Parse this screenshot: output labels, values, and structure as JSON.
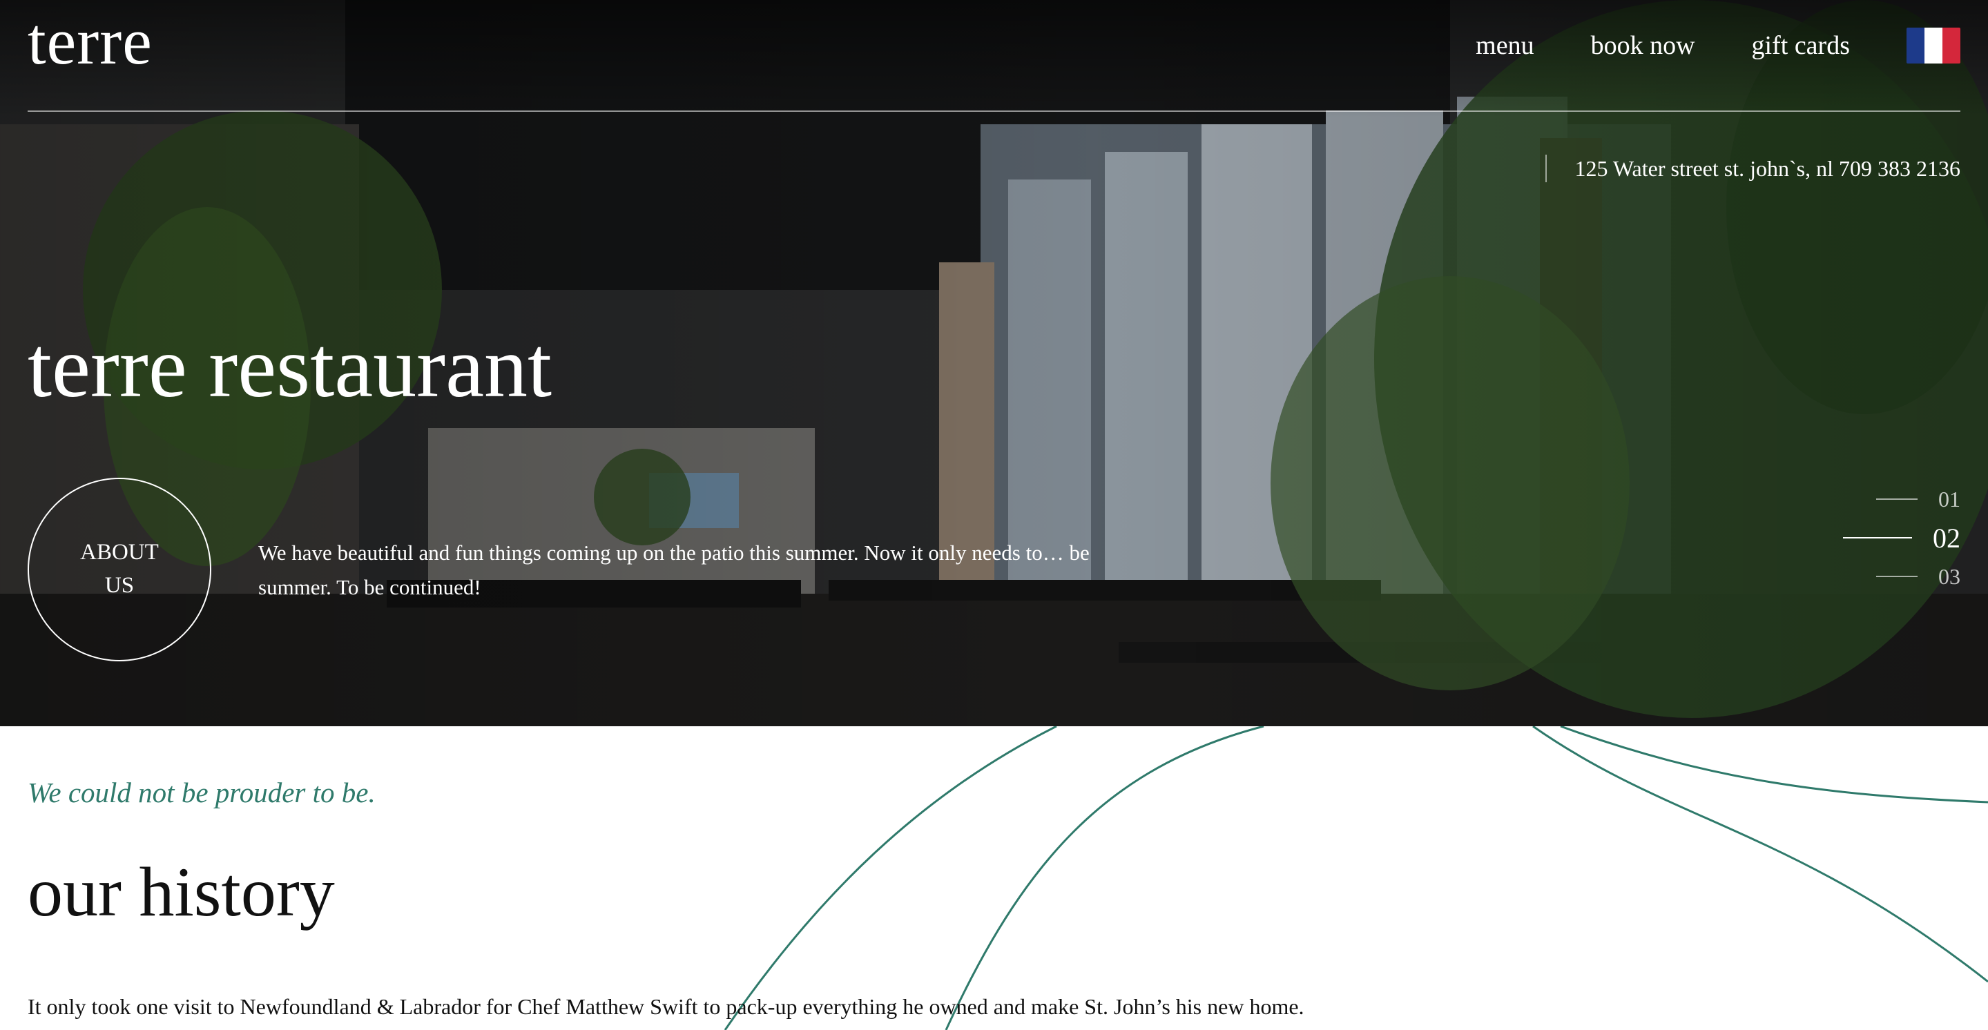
{
  "header": {
    "logo": "terre",
    "nav": [
      {
        "label": "menu"
      },
      {
        "label": "book now"
      },
      {
        "label": "gift cards"
      }
    ],
    "language_flag": {
      "icon": "france-flag-icon",
      "colors": [
        "#1d3a8a",
        "#ffffff",
        "#d4273b"
      ]
    }
  },
  "hero": {
    "address": "125 Water street st. john`s, nl 709 383 2136",
    "title": "terre restaurant",
    "about_button": {
      "line1": "ABOUT",
      "line2": "US"
    },
    "text": "We have beautiful and fun things coming up on the patio this summer. Now it only needs to… be summer. To be continued!",
    "slides": [
      {
        "label": "01",
        "active": false
      },
      {
        "label": "02",
        "active": true
      },
      {
        "label": "03",
        "active": false
      }
    ]
  },
  "history": {
    "tagline": "We could not be prouder to be.",
    "title": "our history",
    "text": "It only took one visit to Newfoundland & Labrador for Chef Matthew Swift to pack-up everything he owned and make St. John’s his new home."
  },
  "colors": {
    "accent": "#2f7a6b",
    "text": "#111111",
    "hero_text": "#ffffff"
  }
}
